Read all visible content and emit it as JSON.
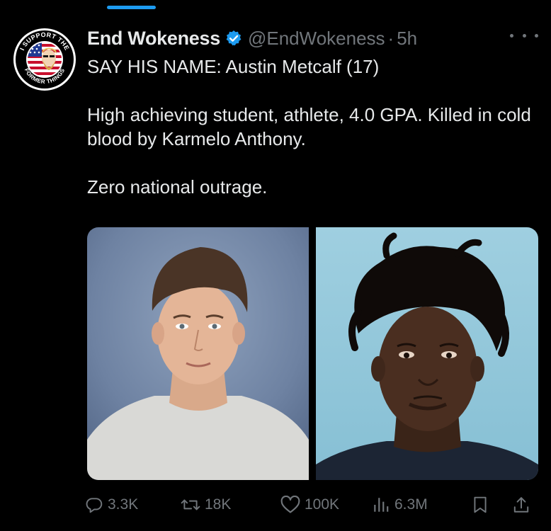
{
  "tweet": {
    "display_name": "End Wokeness",
    "handle": "@EndWokeness",
    "separator": "·",
    "time": "5h",
    "verified": true,
    "text_lines": [
      "SAY HIS NAME: Austin Metcalf (17)",
      "High achieving student, athlete, 4.0 GPA. Killed in cold blood by Karmelo Anthony.",
      "Zero national outrage."
    ],
    "avatar": {
      "icon": "support-former-things-logo-icon",
      "logo_text_top": "I SUPPORT THE",
      "logo_text_bottom": "FORMER THINGS"
    },
    "media": [
      {
        "icon": "portrait-photo-left"
      },
      {
        "icon": "portrait-photo-right"
      }
    ]
  },
  "actions": {
    "reply": {
      "icon": "reply-icon",
      "count": "3.3K"
    },
    "retweet": {
      "icon": "retweet-icon",
      "count": "18K"
    },
    "like": {
      "icon": "heart-icon",
      "count": "100K"
    },
    "views": {
      "icon": "views-chart-icon",
      "count": "6.3M"
    },
    "bookmark": {
      "icon": "bookmark-icon"
    },
    "share": {
      "icon": "share-icon"
    }
  },
  "colors": {
    "background": "#000000",
    "text": "#e7e9ea",
    "secondary": "#71767b",
    "accent": "#1d9bf0"
  }
}
